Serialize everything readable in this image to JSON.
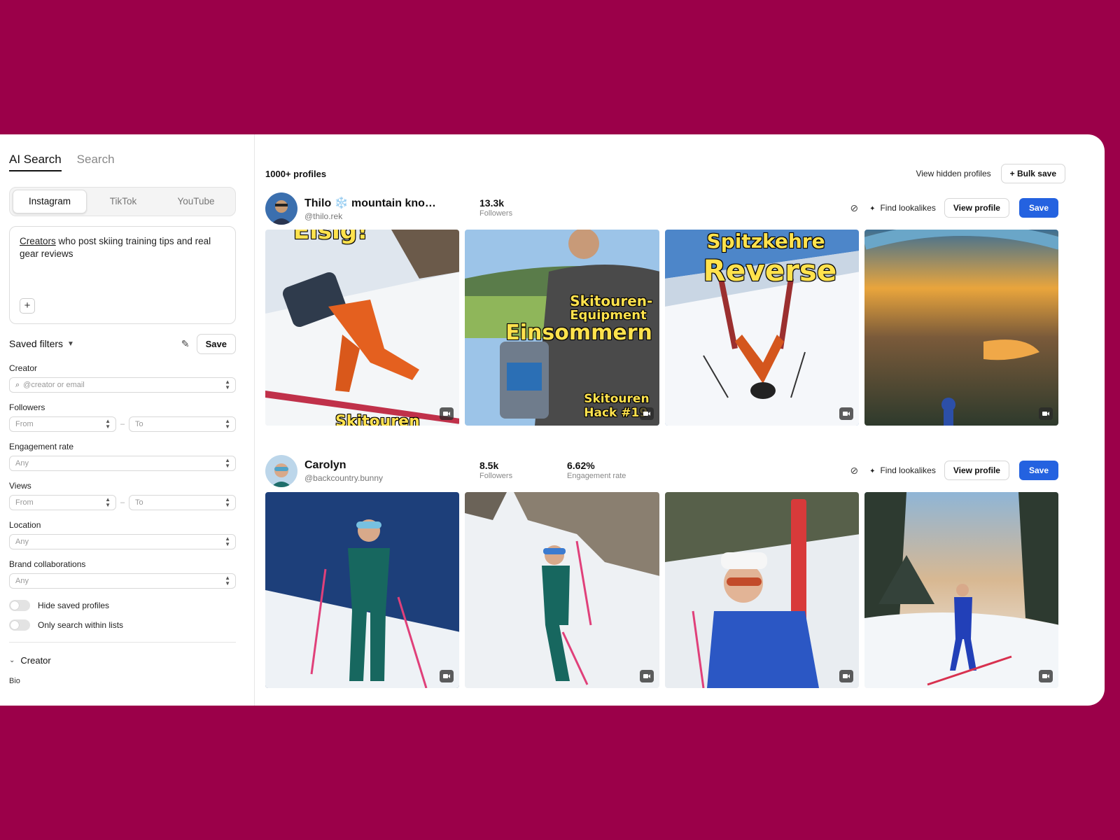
{
  "sidebar": {
    "tabs": [
      "AI Search",
      "Search"
    ],
    "platforms": [
      "Instagram",
      "TikTok",
      "YouTube"
    ],
    "prompt": {
      "highlight": "Creators",
      "rest": " who post skiing training tips and real gear reviews"
    },
    "saved_filters_label": "Saved filters",
    "save_label": "Save",
    "filters": {
      "creator_label": "Creator",
      "creator_placeholder": "@creator or email",
      "followers_label": "Followers",
      "from": "From",
      "to": "To",
      "range_dash": "–",
      "engagement_label": "Engagement rate",
      "any": "Any",
      "views_label": "Views",
      "location_label": "Location",
      "brand_label": "Brand collaborations"
    },
    "toggles": [
      "Hide saved profiles",
      "Only search within lists"
    ],
    "section_creator": "Creator",
    "bio_label": "Bio"
  },
  "main": {
    "count": "1000+ profiles",
    "view_hidden": "View hidden profiles",
    "bulk_save": "+ Bulk save",
    "find_lookalikes": "Find lookalikes",
    "view_profile": "View profile",
    "save": "Save",
    "creators": [
      {
        "name": "Thilo ❄️ mountain kno…",
        "handle": "@thilo.rek",
        "followers": "13.3k",
        "followers_label": "Followers",
        "tiles": [
          {
            "overlay": [
              "Eisig!",
              "Skitouren"
            ]
          },
          {
            "overlay": [
              "Skitouren-",
              "Equipment",
              "Einsommern",
              "Skitouren",
              "Hack #19"
            ]
          },
          {
            "overlay": [
              "Spitzkehre",
              "Reverse"
            ]
          },
          {
            "overlay": []
          }
        ]
      },
      {
        "name": "Carolyn",
        "handle": "@backcountry.bunny",
        "followers": "8.5k",
        "followers_label": "Followers",
        "engagement": "6.62%",
        "engagement_label": "Engagement rate"
      }
    ]
  },
  "colors": {
    "background": "#9b0049",
    "accent": "#2462e0",
    "overlay_yellow": "#ffe24d"
  }
}
